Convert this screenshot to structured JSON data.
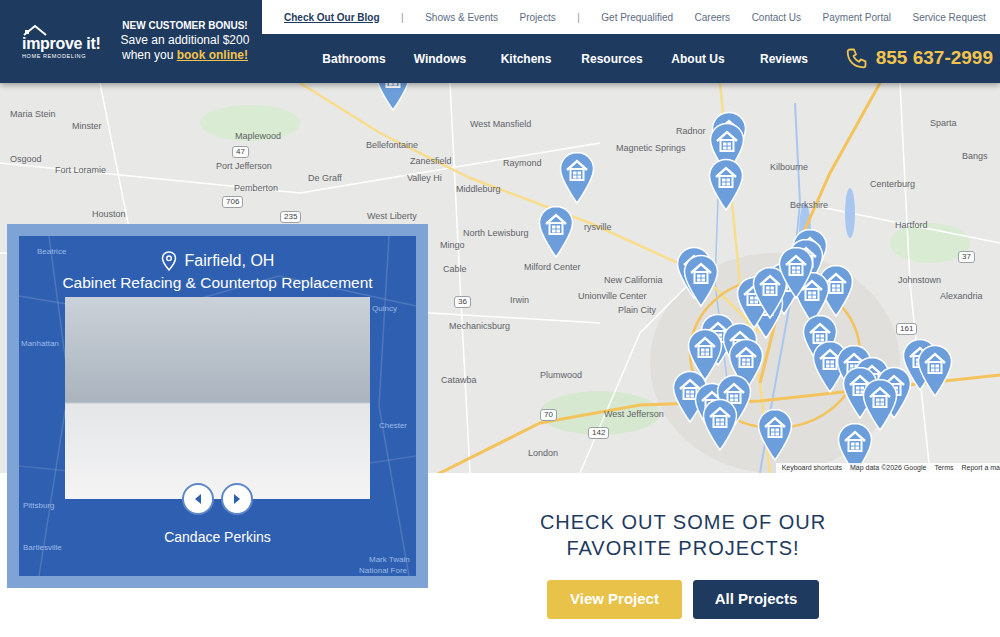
{
  "header": {
    "logo": {
      "name": "improve it!",
      "tagline": "HOME REMODELING"
    },
    "bonus": {
      "title": "NEW CUSTOMER BONUS!",
      "line": "Save an additional $200",
      "prefix": "when you ",
      "link": "book online!"
    },
    "top_links": [
      {
        "label": "Check Out Our Blog",
        "kind": "featured"
      },
      {
        "label": "|",
        "kind": "separator"
      },
      {
        "label": "Shows & Events",
        "kind": "link"
      },
      {
        "label": "Projects",
        "kind": "link"
      },
      {
        "label": "|",
        "kind": "separator"
      },
      {
        "label": "Get Prequalified",
        "kind": "link"
      },
      {
        "label": "Careers",
        "kind": "link"
      },
      {
        "label": "Contact Us",
        "kind": "link"
      },
      {
        "label": "Payment Portal",
        "kind": "link"
      },
      {
        "label": "Service Request",
        "kind": "link"
      }
    ],
    "nav": [
      "Bathrooms",
      "Windows",
      "Kitchens",
      "Resources",
      "About Us",
      "Reviews"
    ],
    "phone": "855 637-2999"
  },
  "map": {
    "labels": [
      "Maria Stein",
      "Minster",
      "Maplewood",
      "Osgood",
      "Fort Loramie",
      "Port Jefferson",
      "Pemberton",
      "De Graff",
      "Houston",
      "West Liberty",
      "West Mansfield",
      "Bellefontaine",
      "Zanesfield",
      "Valley Hi",
      "Middleburg",
      "Raymond",
      "Magnetic Springs",
      "Radnor",
      "Kilbourne",
      "Sparta",
      "Bangs",
      "Centerburg",
      "Berkshire",
      "Hartford",
      "North Lewisburg",
      "rysville",
      "Mingo",
      "Milford Center",
      "Cable",
      "New California",
      "Unionville Center",
      "Irwin",
      "Johnstown",
      "Alexandria",
      "Plain City",
      "Mechanicsburg",
      "Catawba",
      "Plumwood",
      "West Jefferson",
      "London"
    ],
    "route_shields": [
      "47",
      "706",
      "235",
      "36",
      "70",
      "142",
      "161",
      "37"
    ],
    "attribution": [
      "Keyboard shortcuts",
      "Map data ©2026 Google",
      "Terms",
      "Report a ma"
    ]
  },
  "project_card": {
    "location": "Fairfield, OH",
    "title": "Cabinet Refacing & Countertop Replacement",
    "customer": "Candace Perkins",
    "background_labels": [
      "Beatrice",
      "Manhattan",
      "Quincy",
      "Chester",
      "Pittsburg",
      "Bartlesville",
      "Mark Twain",
      "National Fore"
    ]
  },
  "cta": {
    "title": [
      "CHECK OUT SOME OF OUR",
      "FAVORITE PROJECTS!"
    ],
    "buttons": [
      {
        "label": "View Project",
        "kind": "primary"
      },
      {
        "label": "All Projects",
        "kind": "secondary"
      }
    ]
  }
}
